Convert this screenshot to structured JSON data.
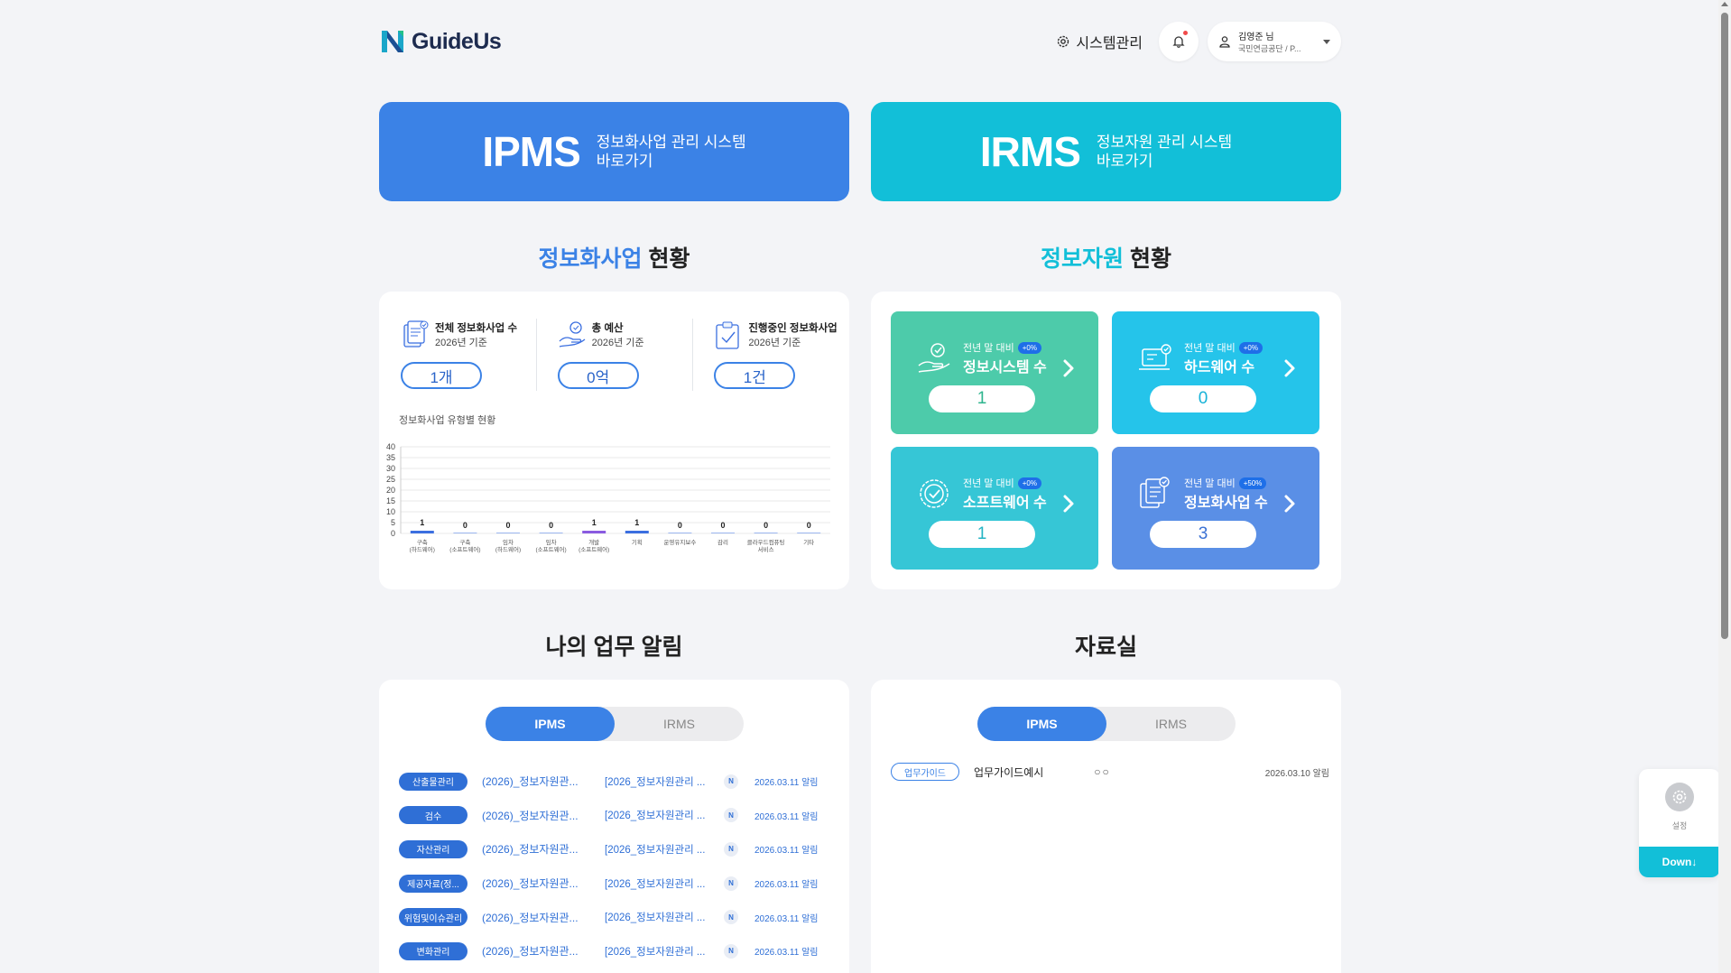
{
  "header": {
    "logo_text": "GuideUs",
    "system_label": "시스템관리",
    "user_name": "김영준 님",
    "user_org": "국민연금공단 / P..."
  },
  "banners": [
    {
      "big": "IPMS",
      "sub1": "정보화사업 관리 시스템",
      "sub2": "바로가기"
    },
    {
      "big": "IRMS",
      "sub1": "정보자원 관리 시스템",
      "sub2": "바로가기"
    }
  ],
  "sections": {
    "project_status_hl": "정보화사업",
    "project_status_rest": " 현황",
    "resource_status_hl": "정보자원",
    "resource_status_rest": " 현황",
    "my_alerts": "나의 업무 알림",
    "library": "자료실"
  },
  "stats": [
    {
      "title": "전체 정보화사업 수",
      "sub": "2026년 기준",
      "value": "1개"
    },
    {
      "title": "총 예산",
      "sub": "2026년 기준",
      "value": "0억"
    },
    {
      "title": "진행중인 정보화사업",
      "sub": "2026년 기준",
      "value": "1건"
    }
  ],
  "chart_title": "정보화사업 유형별 현황",
  "chart_data": {
    "type": "bar",
    "categories": [
      [
        "구축",
        "(하드웨어)"
      ],
      [
        "구축",
        "(소프트웨어)"
      ],
      [
        "임차",
        "(하드웨어)"
      ],
      [
        "임차",
        "(소프트웨어)"
      ],
      [
        "개발",
        "(소프트웨어)"
      ],
      [
        "기획"
      ],
      [
        "운영유지보수"
      ],
      [
        "감리"
      ],
      [
        "클라우드컴퓨팅",
        "서비스"
      ],
      [
        "기타"
      ]
    ],
    "values": [
      1,
      0,
      0,
      0,
      1,
      1,
      0,
      0,
      0,
      0
    ],
    "bar_colors": [
      "#3b6fe0",
      "#3b6fe0",
      "#3b6fe0",
      "#3b6fe0",
      "#8a5be0",
      "#3b6fe0",
      "#3b6fe0",
      "#3b6fe0",
      "#3b6fe0",
      "#3b6fe0"
    ],
    "ylim": [
      0,
      40
    ],
    "yticks": [
      0,
      5,
      10,
      15,
      20,
      25,
      30,
      35,
      40
    ],
    "grid": true
  },
  "tiles": [
    {
      "cmp": "전년 말 대비",
      "badge": "+0%",
      "name": "정보시스템 수",
      "value": "1",
      "color": "green"
    },
    {
      "cmp": "전년 말 대비",
      "badge": "+0%",
      "name": "하드웨어 수",
      "value": "0",
      "color": "sky"
    },
    {
      "cmp": "전년 말 대비",
      "badge": "+0%",
      "name": "소프트웨어 수",
      "value": "1",
      "color": "teal"
    },
    {
      "cmp": "전년 말 대비",
      "badge": "+50%",
      "name": "정보화사업 수",
      "value": "3",
      "color": "blue"
    }
  ],
  "tabs": {
    "ipms": "IPMS",
    "irms": "IRMS"
  },
  "tasks": [
    {
      "tag": "산출물관리",
      "t1": "(2026)_정보자원관...",
      "t2": "[2026_정보자원관리 ...",
      "n": "N",
      "date": "2026.03.11 알림"
    },
    {
      "tag": "검수",
      "t1": "(2026)_정보자원관...",
      "t2": "[2026_정보자원관리 ...",
      "n": "N",
      "date": "2026.03.11 알림"
    },
    {
      "tag": "자산관리",
      "t1": "(2026)_정보자원관...",
      "t2": "[2026_정보자원관리 ...",
      "n": "N",
      "date": "2026.03.11 알림"
    },
    {
      "tag": "제공자료(정...",
      "t1": "(2026)_정보자원관...",
      "t2": "[2026_정보자원관리 ...",
      "n": "N",
      "date": "2026.03.11 알림"
    },
    {
      "tag": "위험및이슈관리",
      "t1": "(2026)_정보자원관...",
      "t2": "[2026_정보자원관리 ...",
      "n": "N",
      "date": "2026.03.11 알림"
    },
    {
      "tag": "변화관리",
      "t1": "(2026)_정보자원관...",
      "t2": "[2026_정보자원관리 ...",
      "n": "N",
      "date": "2026.03.11 알림"
    }
  ],
  "docs": [
    {
      "tag": "업무가이드",
      "title": "업무가이드예시",
      "dots": "○○",
      "date": "2026.03.10 알림"
    }
  ],
  "float": {
    "label": "설정",
    "down": "Down↓"
  }
}
